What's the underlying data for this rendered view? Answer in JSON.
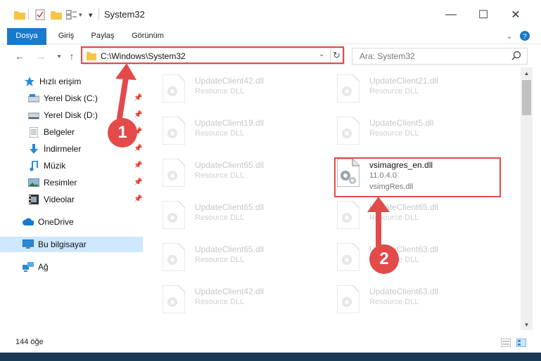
{
  "window": {
    "title": "System32",
    "controls": {
      "minimize": "—",
      "maximize": "☐",
      "close": "✕"
    }
  },
  "ribbon": {
    "tabs": [
      "Dosya",
      "Giriş",
      "Paylaş",
      "Görünüm"
    ]
  },
  "address": {
    "path": "C:\\Windows\\System32",
    "search_placeholder": "Ara: System32"
  },
  "sidebar": {
    "items": [
      {
        "label": "Hızlı erişim",
        "icon": "star-icon"
      },
      {
        "label": "Yerel Disk (C:)",
        "icon": "drive-icon",
        "pinned": true
      },
      {
        "label": "Yerel Disk (D:)",
        "icon": "drive-icon",
        "pinned": true
      },
      {
        "label": "Belgeler",
        "icon": "documents-icon",
        "pinned": true
      },
      {
        "label": "İndirmeler",
        "icon": "download-icon",
        "pinned": true
      },
      {
        "label": "Müzik",
        "icon": "music-icon",
        "pinned": true
      },
      {
        "label": "Resimler",
        "icon": "pictures-icon",
        "pinned": true
      },
      {
        "label": "Videolar",
        "icon": "videos-icon",
        "pinned": true
      },
      {
        "label": "OneDrive",
        "icon": "cloud-icon"
      },
      {
        "label": "Bu bilgisayar",
        "icon": "computer-icon",
        "selected": true
      },
      {
        "label": "Ağ",
        "icon": "network-icon"
      }
    ]
  },
  "files": [
    {
      "name": "UpdateClient42.dll",
      "desc": "Resource DLL"
    },
    {
      "name": "UpdateClient21.dll",
      "desc": "Resource DLL"
    },
    {
      "name": "UpdateClient19.dll",
      "desc": "Resource DLL"
    },
    {
      "name": "UpdateClient5.dll",
      "desc": "Resource DLL"
    },
    {
      "name": "UpdateClient65.dll",
      "desc": "Resource DLL"
    },
    {
      "name": "vsimagres_en.dll",
      "desc": "11.0.4.0",
      "desc2": "vsimgRes.dll",
      "active": true
    },
    {
      "name": "UpdateClient65.dll",
      "desc": "Resource DLL"
    },
    {
      "name": "UpdateClient65.dll",
      "desc": "Resource DLL"
    },
    {
      "name": "UpdateClient65.dll",
      "desc": "Resource DLL"
    },
    {
      "name": "UpdateClient63.dll",
      "desc": "Resource DLL"
    },
    {
      "name": "UpdateClient42.dll",
      "desc": "Resource DLL"
    },
    {
      "name": "UpdateClient63.dll",
      "desc": "Resource DLL"
    }
  ],
  "status": {
    "item_count": "144 öğe"
  },
  "annotations": {
    "badge1": "1",
    "badge2": "2",
    "color": "#e34a4a"
  }
}
